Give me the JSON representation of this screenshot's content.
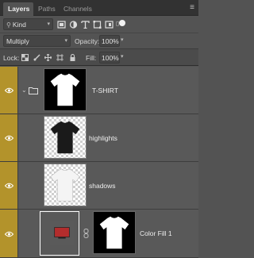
{
  "tabs": [
    {
      "label": "Layers",
      "active": true
    },
    {
      "label": "Paths",
      "active": false
    },
    {
      "label": "Channels",
      "active": false
    }
  ],
  "filter": {
    "kind": "Kind"
  },
  "blend": {
    "mode": "Multiply",
    "opacity_label": "Opacity:",
    "opacity_value": "100%"
  },
  "lock": {
    "label": "Lock:",
    "fill_label": "Fill:",
    "fill_value": "100%"
  },
  "layers": [
    {
      "name": "T-SHIRT",
      "type": "group",
      "visible": true
    },
    {
      "name": "highlights",
      "type": "pixel",
      "visible": true
    },
    {
      "name": "shadows",
      "type": "pixel",
      "visible": true
    },
    {
      "name": "Color Fill 1",
      "type": "fill",
      "visible": true,
      "fill_color": "#b32d2d"
    }
  ],
  "colors": {
    "eye_column": "#b3932b",
    "panel_bg": "#535353"
  }
}
